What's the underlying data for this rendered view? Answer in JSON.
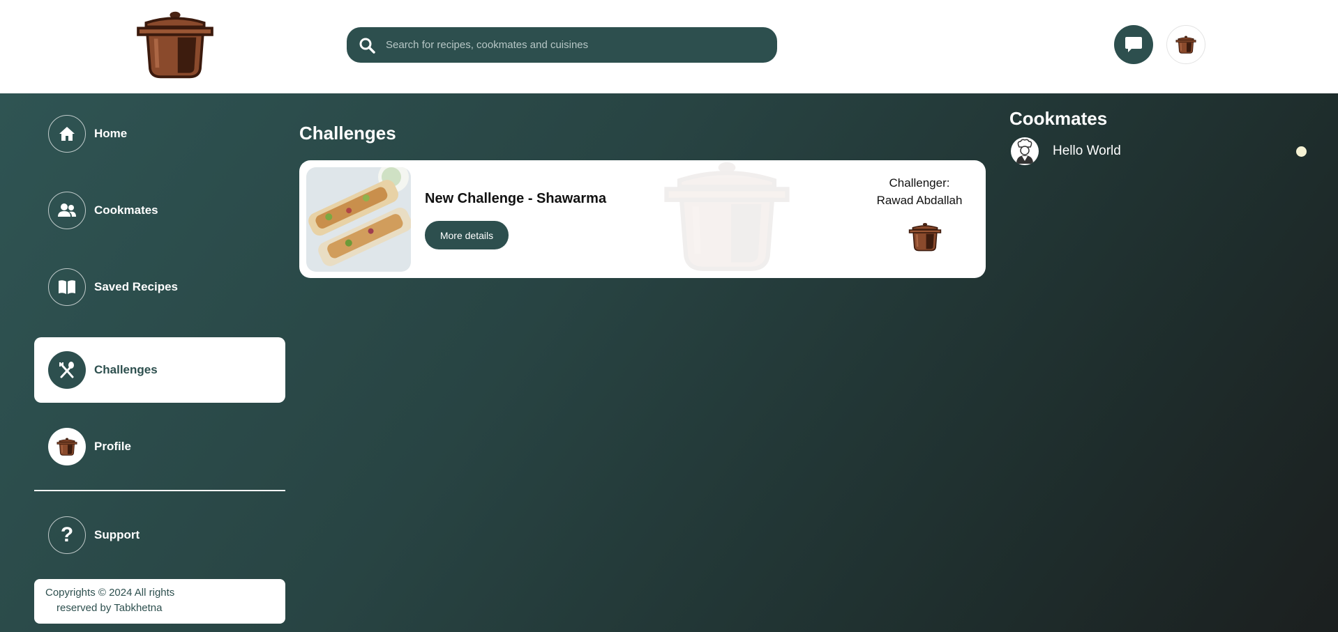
{
  "header": {
    "search_placeholder": "Search for recipes, cookmates and cuisines"
  },
  "sidebar": {
    "items": [
      {
        "label": "Home",
        "icon": "home-icon"
      },
      {
        "label": "Cookmates",
        "icon": "users-icon"
      },
      {
        "label": "Saved Recipes",
        "icon": "book-icon"
      },
      {
        "label": "Challenges",
        "icon": "utensils-icon",
        "active": true
      },
      {
        "label": "Profile",
        "icon": "pot-avatar-icon"
      },
      {
        "label": "Support",
        "icon": "question-icon"
      }
    ],
    "copyright_line1": "Copyrights © 2024 All rights",
    "copyright_line2": "reserved by Tabkhetna"
  },
  "main": {
    "title": "Challenges",
    "challenges": [
      {
        "title": "New Challenge - Shawarma",
        "button": "More details",
        "challenger_label": "Challenger:",
        "challenger_name": "Rawad Abdallah"
      }
    ]
  },
  "cookmates": {
    "title": "Cookmates",
    "items": [
      {
        "name": "Hello World",
        "status": "online"
      }
    ]
  },
  "colors": {
    "primary": "#2d4f4e",
    "pot_brown": "#7a3b20",
    "status_dot": "#f5f2d4"
  }
}
